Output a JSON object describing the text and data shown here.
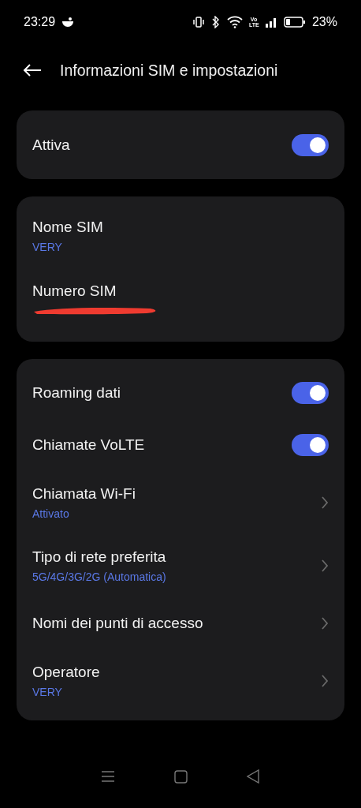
{
  "status_bar": {
    "time": "23:29",
    "volte": "Vo LTE",
    "battery": "23%"
  },
  "header": {
    "title": "Informazioni SIM e impostazioni"
  },
  "cards": [
    {
      "items": [
        {
          "kind": "toggle",
          "label": "Attiva",
          "on": true
        }
      ]
    },
    {
      "items": [
        {
          "kind": "info",
          "label": "Nome SIM",
          "value": "VERY"
        },
        {
          "kind": "redacted",
          "label": "Numero SIM"
        }
      ]
    },
    {
      "items": [
        {
          "kind": "toggle",
          "label": "Roaming dati",
          "on": true
        },
        {
          "kind": "toggle",
          "label": "Chiamate VoLTE",
          "on": true
        },
        {
          "kind": "link",
          "label": "Chiamata Wi-Fi",
          "value": "Attivato"
        },
        {
          "kind": "link",
          "label": "Tipo di rete preferita",
          "value": "5G/4G/3G/2G (Automatica)"
        },
        {
          "kind": "link",
          "label": "Nomi dei punti di accesso"
        },
        {
          "kind": "link",
          "label": "Operatore",
          "value": "VERY"
        }
      ]
    }
  ]
}
